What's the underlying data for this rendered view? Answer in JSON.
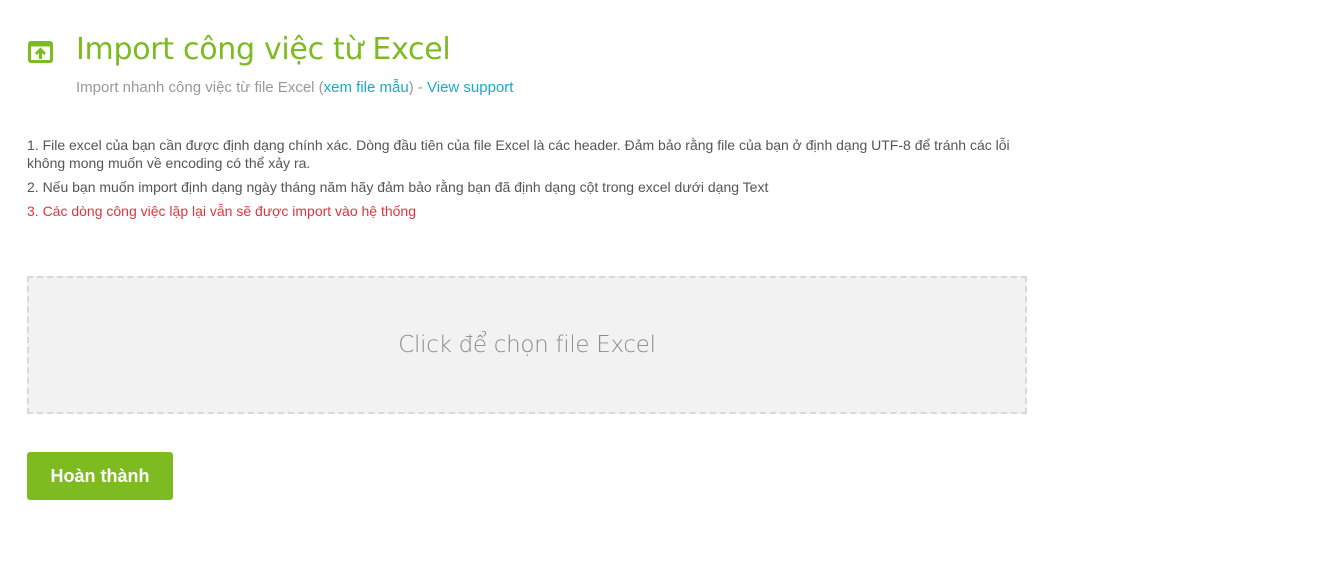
{
  "header": {
    "title": "Import công việc từ Excel",
    "subtitle_prefix": "Import nhanh công việc từ file Excel (",
    "sample_link": "xem file mẫu",
    "subtitle_mid": ") - ",
    "support_link": "View support"
  },
  "notes": [
    "1. File excel của bạn cần được định dạng chính xác. Dòng đầu tiên của file Excel là các header. Đảm bảo rằng file của bạn ở định dạng UTF-8 để tránh các lỗi không mong muốn về encoding có thể xảy ra.",
    "2. Nếu bạn muốn import định dạng ngày tháng năm hãy đảm bảo rằng bạn đã định dạng cột trong excel dưới dạng Text",
    "3. Các dòng công việc lặp lại vẫn sẽ được import vào hệ thống"
  ],
  "dropzone": {
    "label": "Click để chọn file Excel"
  },
  "actions": {
    "finish_label": "Hoàn thành"
  },
  "colors": {
    "accent": "#7dbb21",
    "link": "#1ba9c7",
    "warning": "#e2333d"
  },
  "icons": {
    "header_icon": "import-upload-icon"
  }
}
